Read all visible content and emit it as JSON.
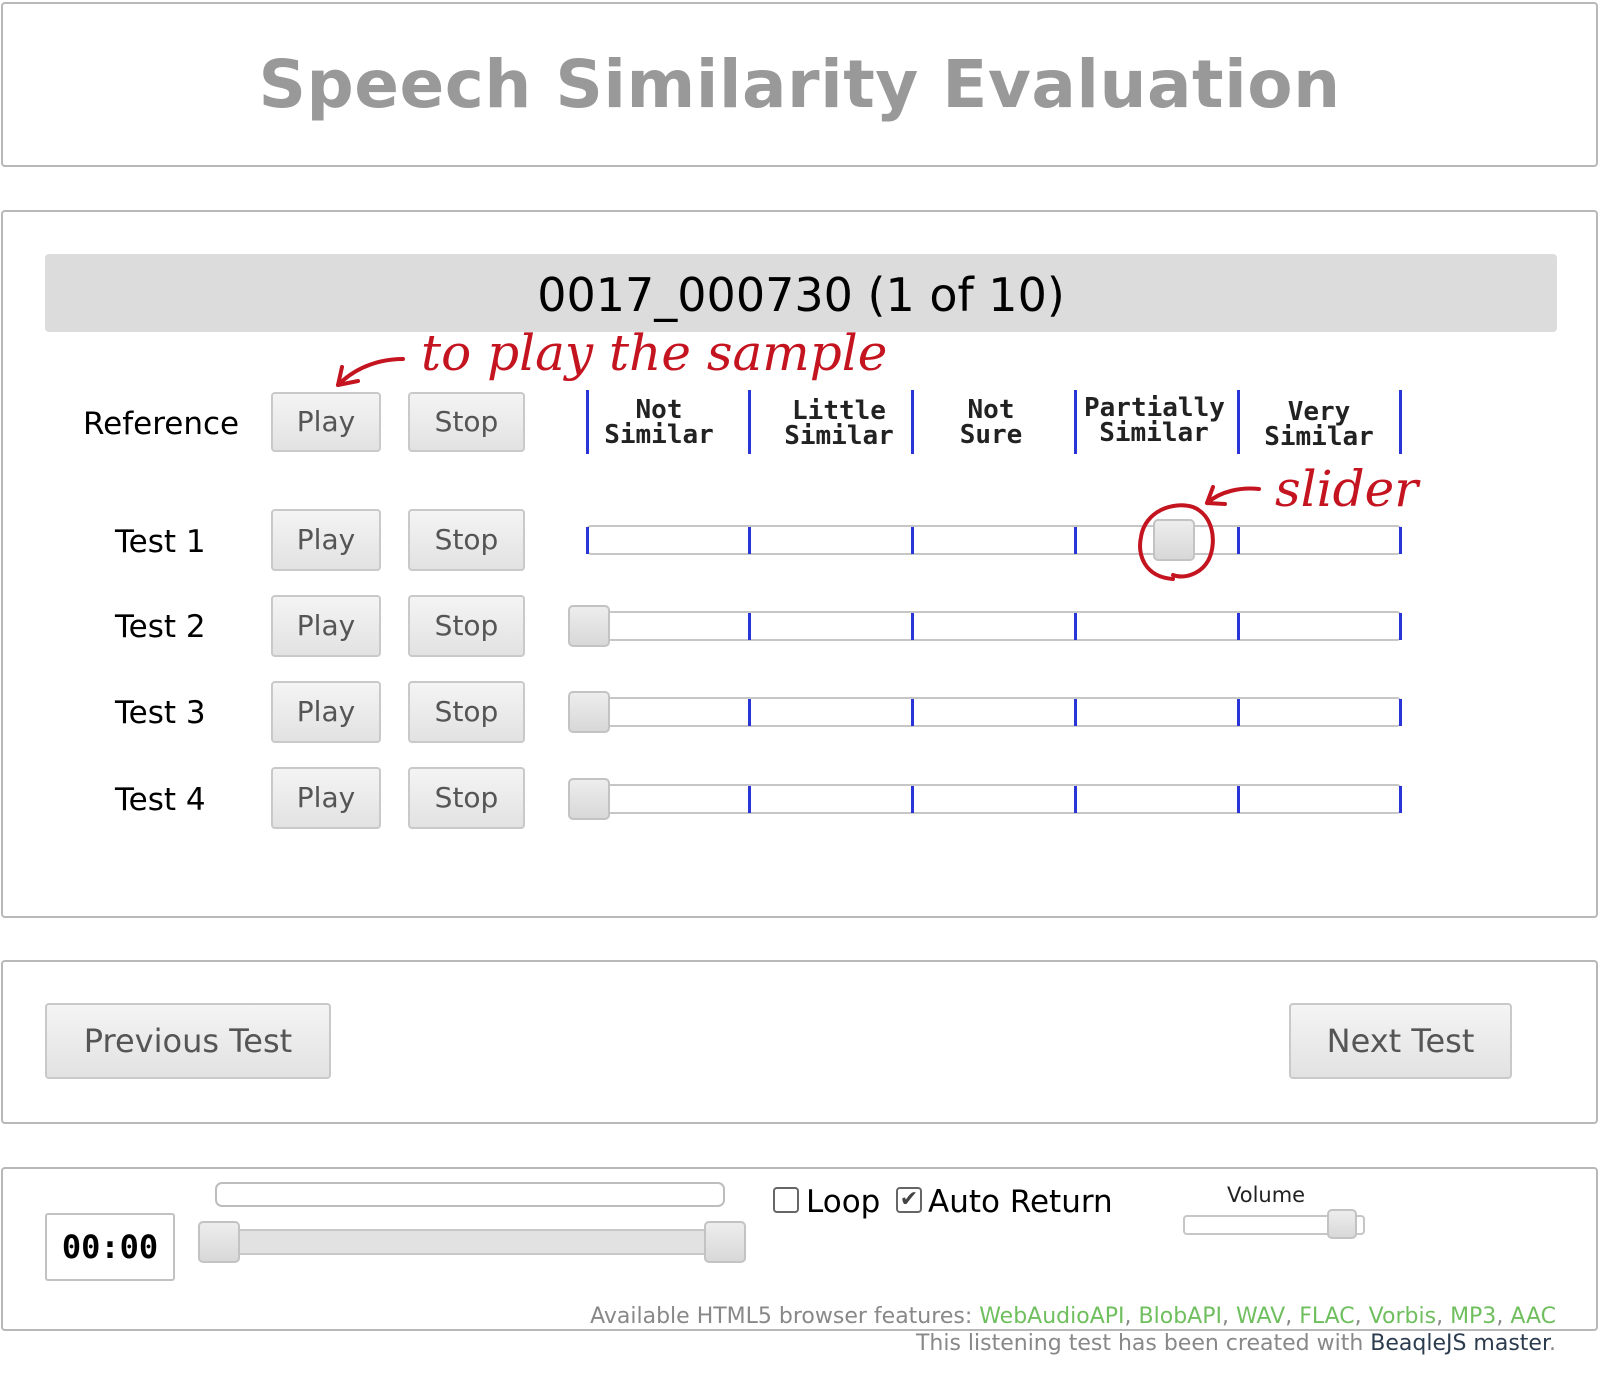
{
  "title": "Speech Similarity Evaluation",
  "test_header": "0017_000730 (1 of 10)",
  "reference": {
    "label": "Reference",
    "play_label": "Play",
    "stop_label": "Stop"
  },
  "scale_labels": [
    {
      "line1": "Not",
      "line2": "Similar"
    },
    {
      "line1": "Little",
      "line2": "Similar"
    },
    {
      "line1": "Not",
      "line2": "Sure"
    },
    {
      "line1": "Partially",
      "line2": "Similar"
    },
    {
      "line1": "Very",
      "line2": "Similar"
    }
  ],
  "tests": [
    {
      "label": "Test 1",
      "play_label": "Play",
      "stop_label": "Stop",
      "rating": 0.72
    },
    {
      "label": "Test 2",
      "play_label": "Play",
      "stop_label": "Stop",
      "rating": 0
    },
    {
      "label": "Test 3",
      "play_label": "Play",
      "stop_label": "Stop",
      "rating": 0
    },
    {
      "label": "Test 4",
      "play_label": "Play",
      "stop_label": "Stop",
      "rating": 0
    }
  ],
  "annotations": {
    "play_hint": "to play the sample",
    "slider_hint": "slider"
  },
  "nav": {
    "previous_label": "Previous Test",
    "next_label": "Next Test"
  },
  "player": {
    "time": "00:00",
    "loop_label": "Loop",
    "loop_checked": false,
    "auto_return_label": "Auto Return",
    "auto_return_checked": true,
    "volume_label": "Volume",
    "volume": 0.95
  },
  "footer": {
    "features_prefix": "Available HTML5 browser features: ",
    "features": [
      "WebAudioAPI",
      "BlobAPI",
      "WAV",
      "FLAC",
      "Vorbis",
      "MP3",
      "AAC"
    ],
    "credit_prefix": "This listening test has been created with ",
    "credit_link": "BeaqleJS master",
    "credit_suffix": "."
  },
  "colors": {
    "tick": "#2a35d8",
    "annotation": "#c41420",
    "feature": "#6fbf5f"
  }
}
